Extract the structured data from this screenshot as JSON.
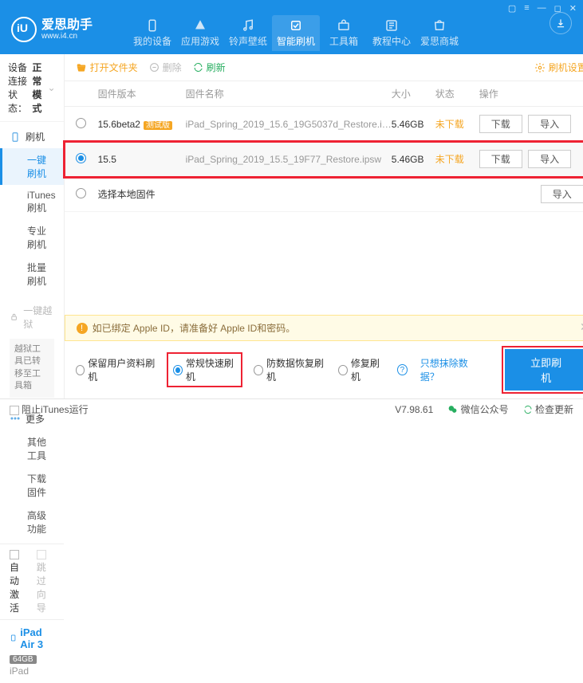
{
  "window": {
    "controls": [
      "▢",
      "≡",
      "—",
      "◻",
      "✕"
    ]
  },
  "brand": {
    "title": "爱思助手",
    "sub": "www.i4.cn"
  },
  "nav": {
    "items": [
      {
        "label": "我的设备"
      },
      {
        "label": "应用游戏"
      },
      {
        "label": "铃声壁纸"
      },
      {
        "label": "智能刷机",
        "active": true
      },
      {
        "label": "工具箱"
      },
      {
        "label": "教程中心"
      },
      {
        "label": "爱思商城"
      }
    ]
  },
  "sidebar": {
    "conn_label": "设备连接状态：",
    "conn_value": "正常模式",
    "group_flash": "刷机",
    "flash_items": [
      "一键刷机",
      "iTunes刷机",
      "专业刷机",
      "批量刷机"
    ],
    "group_jb": "一键越狱",
    "jb_note": "越狱工具已转移至工具箱",
    "group_more": "更多",
    "more_items": [
      "其他工具",
      "下载固件",
      "高级功能"
    ],
    "auto_activate": "自动激活",
    "skip_guide": "跳过向导",
    "device": "iPad Air 3",
    "storage": "64GB",
    "model": "iPad"
  },
  "toolbar": {
    "open": "打开文件夹",
    "delete": "删除",
    "refresh": "刷新",
    "settings": "刷机设置"
  },
  "table": {
    "headers": {
      "ver": "固件版本",
      "name": "固件名称",
      "size": "大小",
      "status": "状态",
      "ops": "操作"
    },
    "rows": [
      {
        "selected": false,
        "ver": "15.6beta2",
        "beta": "测试版",
        "name": "iPad_Spring_2019_15.6_19G5037d_Restore.i…",
        "size": "5.46GB",
        "status": "未下载"
      },
      {
        "selected": true,
        "ver": "15.5",
        "beta": "",
        "name": "iPad_Spring_2019_15.5_19F77_Restore.ipsw",
        "size": "5.46GB",
        "status": "未下载"
      }
    ],
    "local_radio": "选择本地固件",
    "btn_dl": "下载",
    "btn_imp": "导入"
  },
  "alert": "如已绑定 Apple ID，请准备好 Apple ID和密码。",
  "options": {
    "keep": "保留用户资料刷机",
    "normal": "常规快速刷机",
    "antirec": "防数据恢复刷机",
    "repair": "修复刷机",
    "clearlink": "只想抹除数据？",
    "go": "立即刷机"
  },
  "statusbar": {
    "block": "阻止iTunes运行",
    "ver": "V7.98.61",
    "wechat": "微信公众号",
    "update": "检查更新"
  }
}
